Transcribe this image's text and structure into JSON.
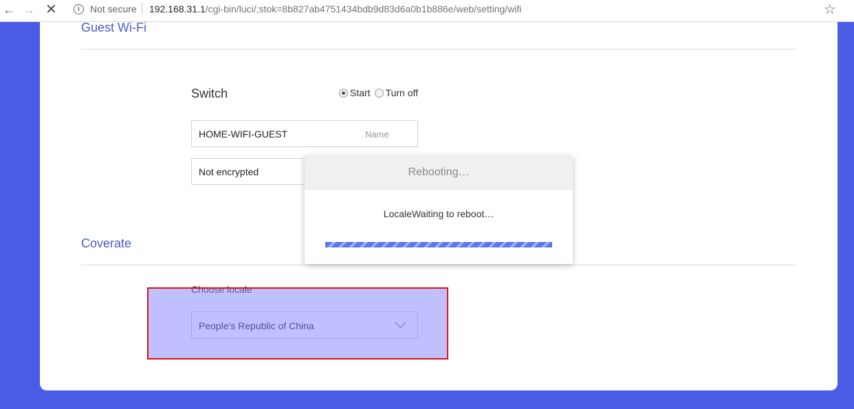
{
  "browser": {
    "security_label": "Not secure",
    "url_host": "192.168.31.1",
    "url_path": "/cgi-bin/luci/;stok=8b827ab4751434bdb9d83d6a0b1b886e/web/setting/wifi"
  },
  "guest_wifi": {
    "title": "Guest Wi-Fi",
    "switch_label": "Switch",
    "options": [
      "Start",
      "Turn off"
    ],
    "selected": "Start",
    "name_value": "HOME-WIFI-GUEST",
    "name_placeholder": "Name",
    "encryption_value": "Not encrypted"
  },
  "coverage": {
    "title": "Coverate",
    "locale_label": "Choose locale",
    "locale_value": "People's Republic of China"
  },
  "modal": {
    "title": "Rebooting…",
    "message": "LocaleWaiting to reboot…"
  },
  "colors": {
    "background": "#4a5ce3",
    "accent": "#4a5cc8",
    "highlight_border": "#e01010"
  }
}
